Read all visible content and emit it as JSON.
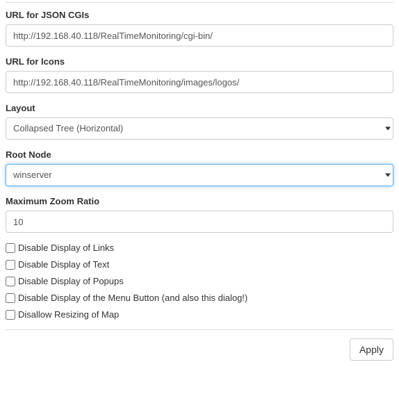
{
  "form": {
    "url_json_cgis": {
      "label": "URL for JSON CGIs",
      "value": "http://192.168.40.118/RealTimeMonitoring/cgi-bin/"
    },
    "url_icons": {
      "label": "URL for Icons",
      "value": "http://192.168.40.118/RealTimeMonitoring/images/logos/"
    },
    "layout": {
      "label": "Layout",
      "value": "Collapsed Tree (Horizontal)"
    },
    "root_node": {
      "label": "Root Node",
      "value": "winserver"
    },
    "max_zoom": {
      "label": "Maximum Zoom Ratio",
      "value": "10"
    },
    "checkboxes": {
      "disable_links": "Disable Display of Links",
      "disable_text": "Disable Display of Text",
      "disable_popups": "Disable Display of Popups",
      "disable_menu": "Disable Display of the Menu Button (and also this dialog!)",
      "disallow_resize": "Disallow Resizing of Map"
    }
  },
  "footer": {
    "apply_label": "Apply"
  }
}
